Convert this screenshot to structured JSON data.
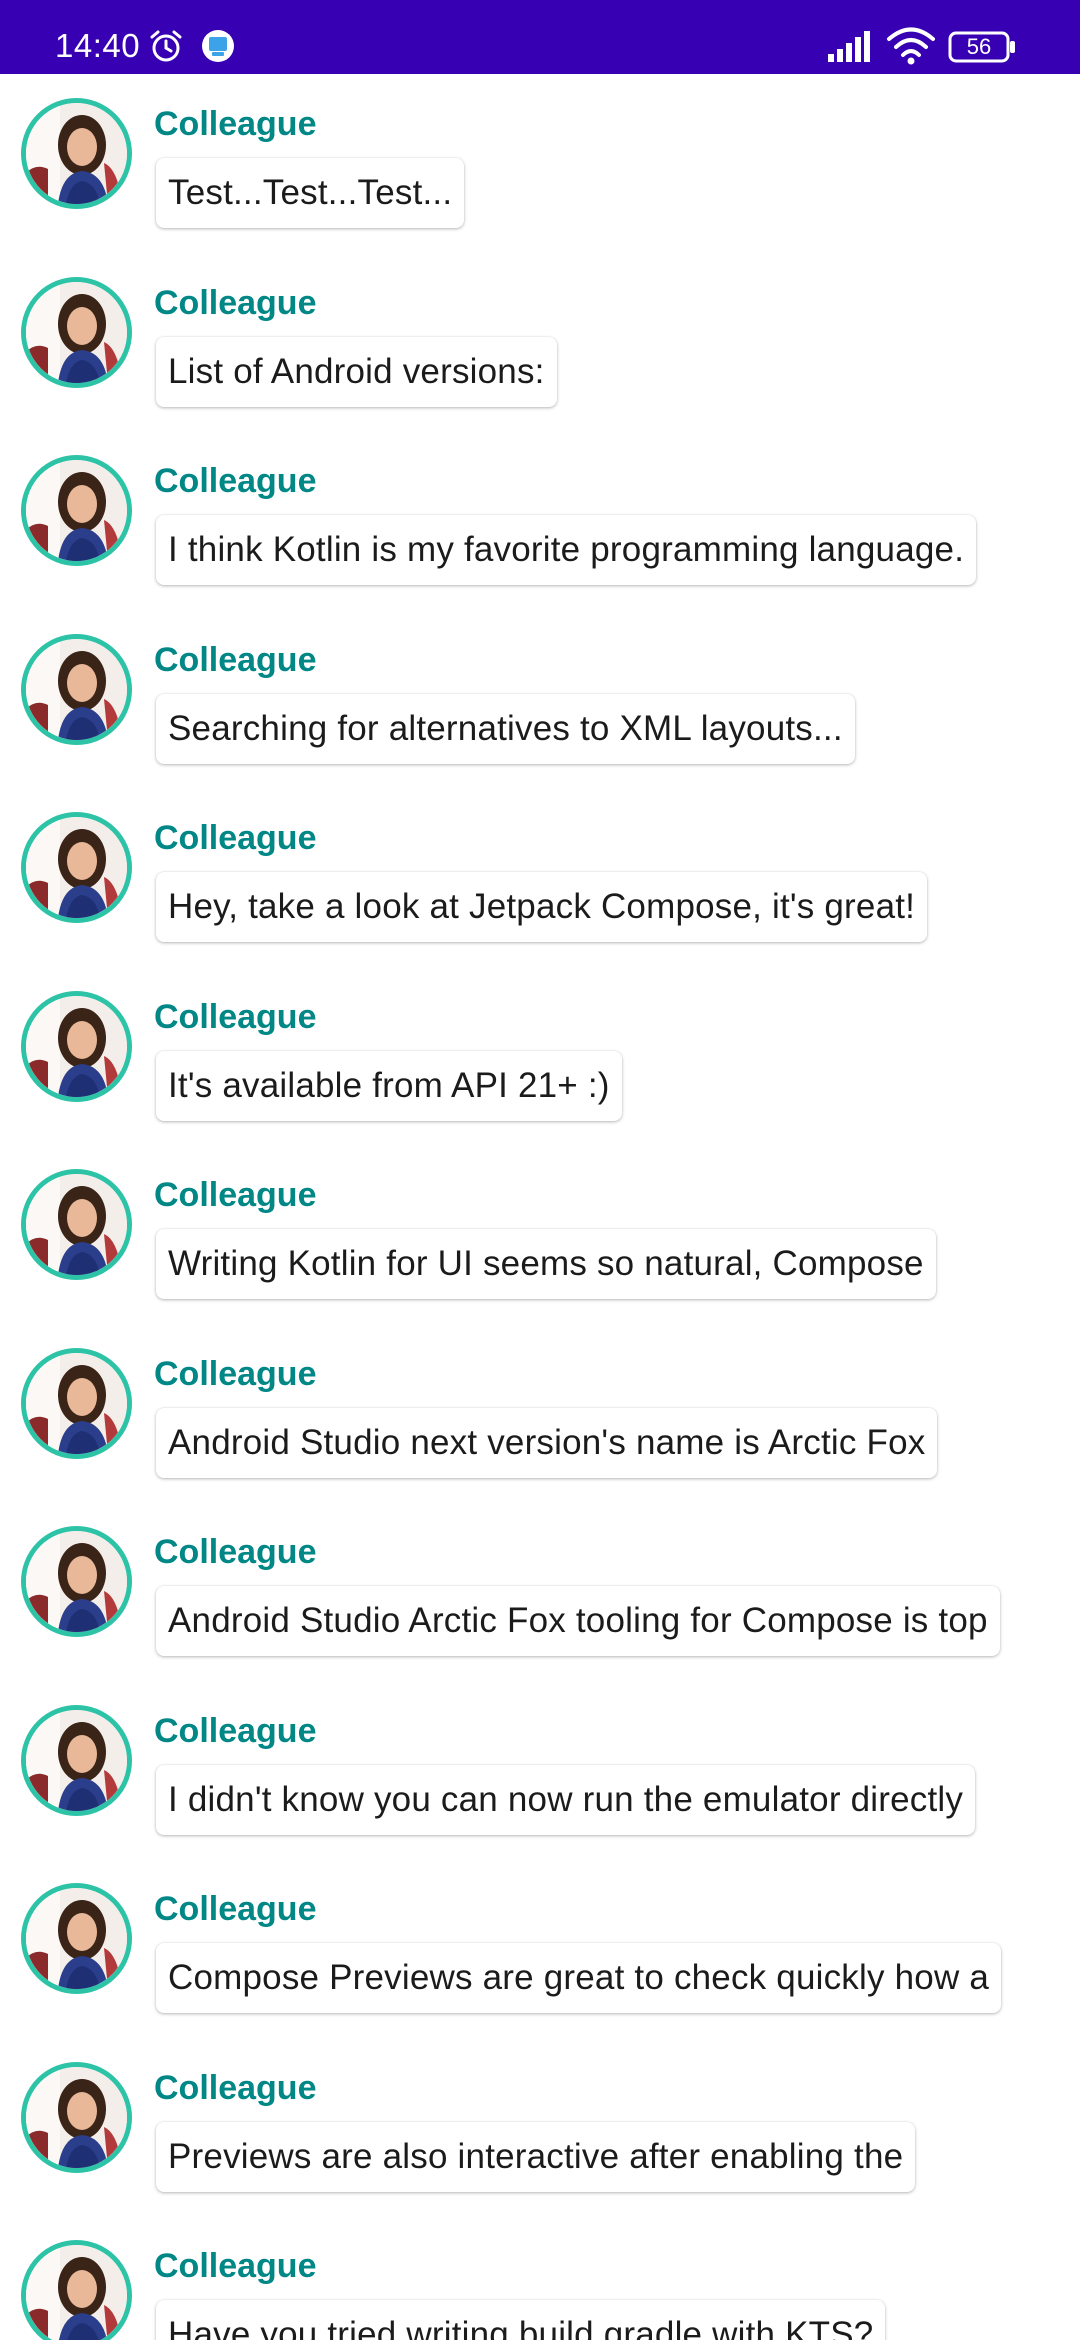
{
  "status_bar": {
    "time": "14:40",
    "battery_level": "56",
    "background_color": "#3700B3",
    "icons": [
      "alarm-icon",
      "app-notification-icon",
      "signal-icon",
      "wifi-icon",
      "battery-icon"
    ]
  },
  "theme": {
    "author_color": "#018786",
    "avatar_border_color": "#2DC3A6"
  },
  "messages": [
    {
      "author": "Colleague",
      "text": "Test...Test...Test..."
    },
    {
      "author": "Colleague",
      "text": "List of Android versions:"
    },
    {
      "author": "Colleague",
      "text": "I think Kotlin is my favorite programming language."
    },
    {
      "author": "Colleague",
      "text": "Searching for alternatives to XML layouts..."
    },
    {
      "author": "Colleague",
      "text": "Hey, take a look at Jetpack Compose, it's great!"
    },
    {
      "author": "Colleague",
      "text": "It's available from API 21+ :)"
    },
    {
      "author": "Colleague",
      "text": "Writing Kotlin for UI seems so natural, Compose"
    },
    {
      "author": "Colleague",
      "text": "Android Studio next version's name is Arctic Fox"
    },
    {
      "author": "Colleague",
      "text": "Android Studio Arctic Fox tooling for Compose is top"
    },
    {
      "author": "Colleague",
      "text": "I didn't know you can now run the emulator directly"
    },
    {
      "author": "Colleague",
      "text": "Compose Previews are great to check quickly how a"
    },
    {
      "author": "Colleague",
      "text": "Previews are also interactive after enabling the"
    },
    {
      "author": "Colleague",
      "text": "Have you tried writing build.gradle with KTS?"
    }
  ]
}
